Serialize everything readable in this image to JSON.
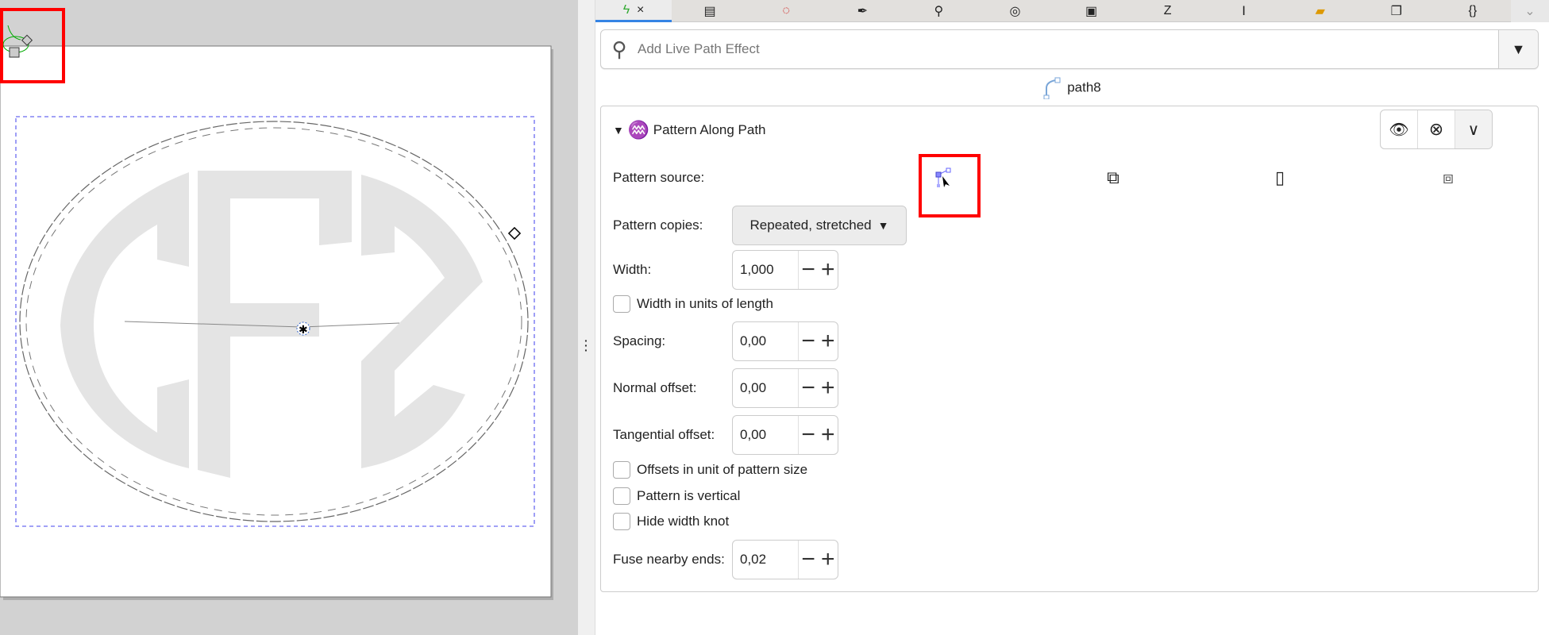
{
  "tabs": [
    "path-effects-icon",
    "align-icon",
    "fill-stroke-icon",
    "pen-icon",
    "find-icon",
    "layers-icon",
    "document-icon",
    "text-icon",
    "transform-icon",
    "export-icon",
    "clone-icon",
    "xml-icon",
    "more-icon"
  ],
  "active_tab_close": "×",
  "search": {
    "placeholder": "Add Live Path Effect"
  },
  "object_name": "path8",
  "effect": {
    "title": "Pattern Along Path",
    "pattern_source_label": "Pattern source:",
    "pattern_copies_label": "Pattern copies:",
    "pattern_copies_value": "Repeated, stretched",
    "width_label": "Width:",
    "width_value": "1,000",
    "width_units_label": "Width in units of length",
    "spacing_label": "Spacing:",
    "spacing_value": "0,00",
    "normal_offset_label": "Normal offset:",
    "normal_offset_value": "0,00",
    "tangential_offset_label": "Tangential offset:",
    "tangential_offset_value": "0,00",
    "offsets_unit_label": "Offsets in unit of pattern size",
    "vertical_label": "Pattern is vertical",
    "hide_knot_label": "Hide width knot",
    "fuse_label": "Fuse nearby ends:",
    "fuse_value": "0,02",
    "minus": "−",
    "plus": "+"
  },
  "colors": {
    "accent": "#3584e4",
    "highlight": "#ff0000",
    "selection": "#6b6bf0",
    "monogram": "#e4e4e4"
  }
}
